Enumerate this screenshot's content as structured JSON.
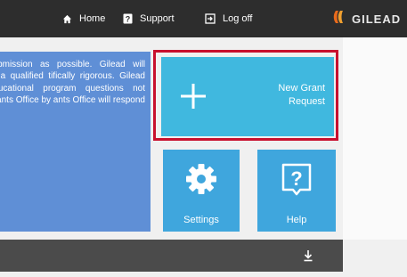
{
  "nav": {
    "home_label": "Home",
    "support_label": "Support",
    "logoff_label": "Log off",
    "logo_text": "GILEAD"
  },
  "info": {
    "text": "the grant submission as possible. Gilead will conducted by a qualified tifically rigorous. Gilead speakers, educational program questions not Gilead Grants Office by ants Office will respond"
  },
  "tiles": {
    "new_grant_label": "New Grant\nRequest",
    "settings_label": "Settings",
    "help_label": "Help"
  },
  "icons": {
    "home": "home-icon",
    "support": "question-icon",
    "logoff": "logout-icon",
    "plus": "plus-icon",
    "gear": "gear-icon",
    "help": "question-icon",
    "download": "download-icon"
  },
  "colors": {
    "topbar": "#2d2d2d",
    "info_background": "#5f8fd6",
    "tile": "#3fa6dd",
    "highlight": "#c8102e",
    "footer": "#4b4b4b"
  }
}
